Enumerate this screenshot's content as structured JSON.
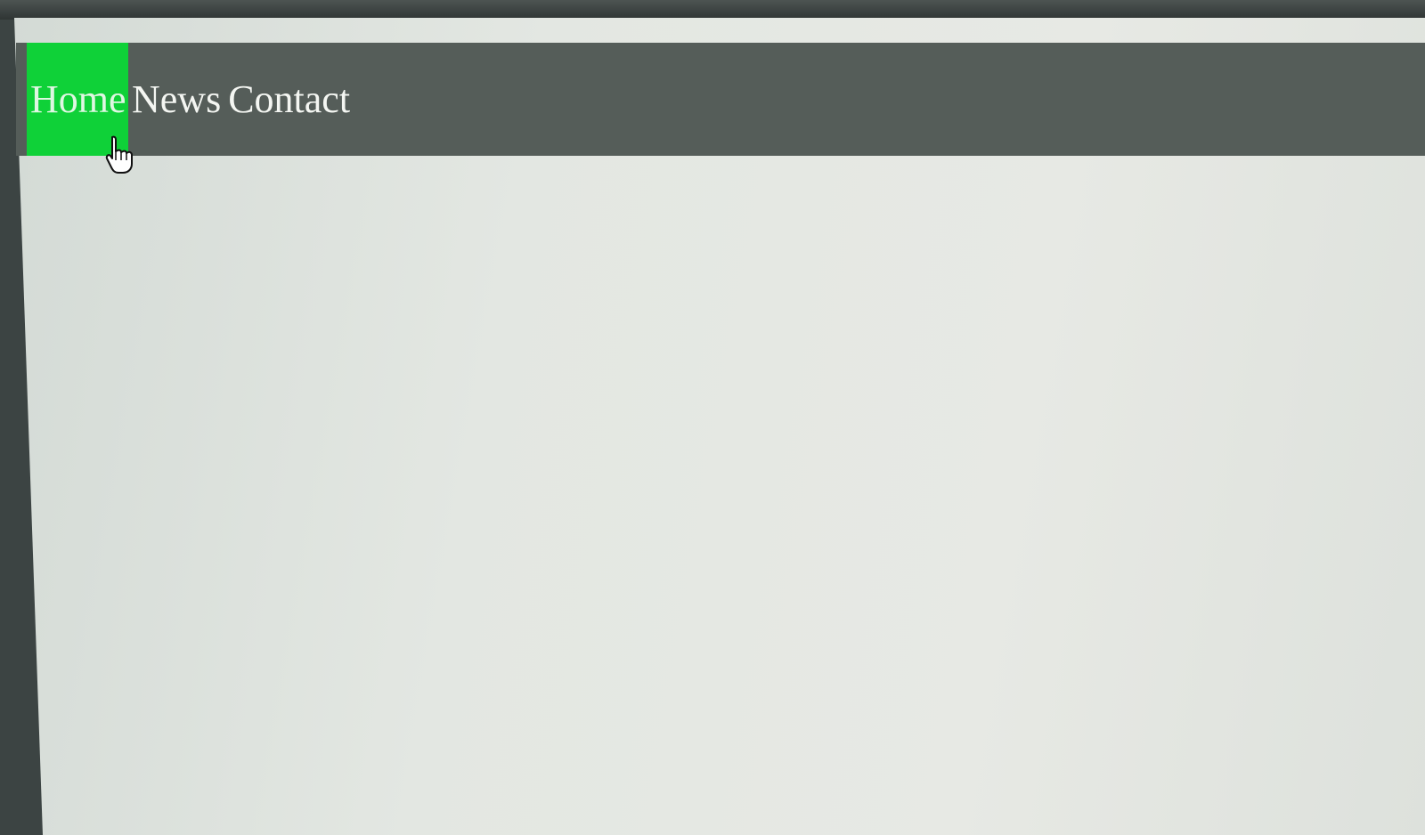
{
  "nav": {
    "items": [
      {
        "label": "Home",
        "active": true
      },
      {
        "label": "News",
        "active": false
      },
      {
        "label": "Contact",
        "active": false
      }
    ],
    "active_color": "#0fd138",
    "bar_color": "#555d59"
  },
  "cursor": {
    "icon": "hand-pointer-icon"
  }
}
